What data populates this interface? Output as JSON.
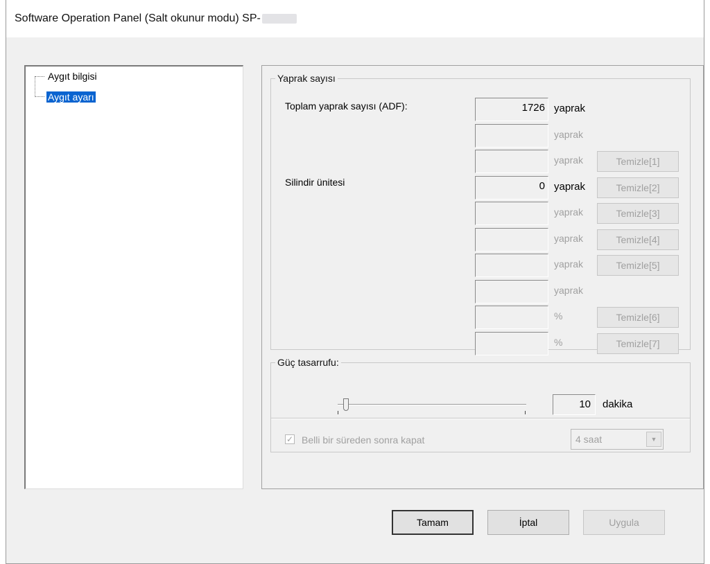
{
  "window": {
    "title": "Software Operation Panel (Salt okunur modu) SP-"
  },
  "tree": {
    "items": [
      {
        "label": "Aygıt bilgisi"
      },
      {
        "label": "Aygıt ayarı"
      }
    ]
  },
  "sheet_counter": {
    "legend": "Yaprak sayısı",
    "total_label": "Toplam yaprak sayısı (ADF):",
    "roller_label": "Silindir ünitesi",
    "rows": [
      {
        "value": "1726",
        "unit": "yaprak",
        "button": ""
      },
      {
        "value": "",
        "unit": "yaprak",
        "button": ""
      },
      {
        "value": "",
        "unit": "yaprak",
        "button": "Temizle[1]"
      },
      {
        "value": "0",
        "unit": "yaprak",
        "button": "Temizle[2]"
      },
      {
        "value": "",
        "unit": "yaprak",
        "button": "Temizle[3]"
      },
      {
        "value": "",
        "unit": "yaprak",
        "button": "Temizle[4]"
      },
      {
        "value": "",
        "unit": "yaprak",
        "button": "Temizle[5]"
      },
      {
        "value": "",
        "unit": "yaprak",
        "button": ""
      },
      {
        "value": "",
        "unit": "%",
        "button": "Temizle[6]"
      },
      {
        "value": "",
        "unit": "%",
        "button": "Temizle[7]"
      }
    ]
  },
  "power_saving": {
    "legend": "Güç tasarrufu:",
    "minutes": "10",
    "minutes_unit": "dakika",
    "slider_level": 0.0,
    "shutdown_label": "Belli bir süreden sonra kapat",
    "shutdown_checked": true,
    "shutdown_select": "4 saat"
  },
  "footer": {
    "ok": "Tamam",
    "cancel": "İptal",
    "apply": "Uygula"
  },
  "colors": {
    "selection": "#0a64d0",
    "disabled_text": "#a0a0a0"
  }
}
